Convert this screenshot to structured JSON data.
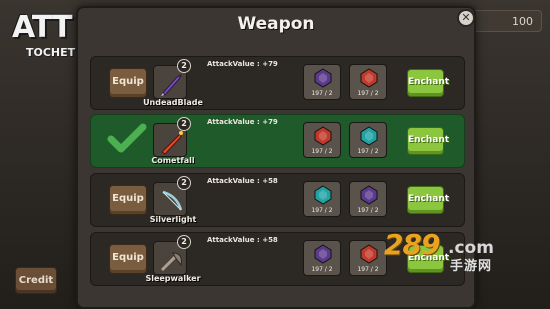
{
  "game": {
    "logo_line1": "ATT",
    "logo_line2": "TOCHET",
    "coin_value": "100",
    "credit_label": "Credit"
  },
  "panel": {
    "title": "Weapon",
    "close_icon": "x"
  },
  "weapons": [
    {
      "action": "Equip",
      "equipped": false,
      "level": "2",
      "name": "UndeadBlade",
      "attack": "AttackValue : +79",
      "gem1": {
        "type": "purple",
        "count": "197 / 2"
      },
      "gem2": {
        "type": "red",
        "count": "197 / 2"
      },
      "enchant": "Enchant"
    },
    {
      "action": "Equipped",
      "equipped": true,
      "level": "2",
      "name": "Cometfall",
      "attack": "AttackValue : +79",
      "gem1": {
        "type": "red",
        "count": "197 / 2"
      },
      "gem2": {
        "type": "teal",
        "count": "197 / 2"
      },
      "enchant": "Enchant"
    },
    {
      "action": "Equip",
      "equipped": false,
      "level": "2",
      "name": "Silverlight",
      "attack": "AttackValue : +58",
      "gem1": {
        "type": "teal",
        "count": "197 / 2"
      },
      "gem2": {
        "type": "purple",
        "count": "197 / 2"
      },
      "enchant": "Enchant"
    },
    {
      "action": "Equip",
      "equipped": false,
      "level": "2",
      "name": "Sleepwalker",
      "attack": "AttackValue : +58",
      "gem1": {
        "type": "purple",
        "count": "197 / 2"
      },
      "gem2": {
        "type": "red",
        "count": "197 / 2"
      },
      "enchant": "Enchant"
    }
  ],
  "watermark": {
    "number": "289",
    "domain": ".com",
    "chinese": "手游网"
  },
  "colors": {
    "selected_row": "#1e5a2a",
    "enchant": "#8cc63f",
    "gem_purple": "#5b3a8c",
    "gem_red": "#c0392b",
    "gem_teal": "#1fa3a3"
  }
}
